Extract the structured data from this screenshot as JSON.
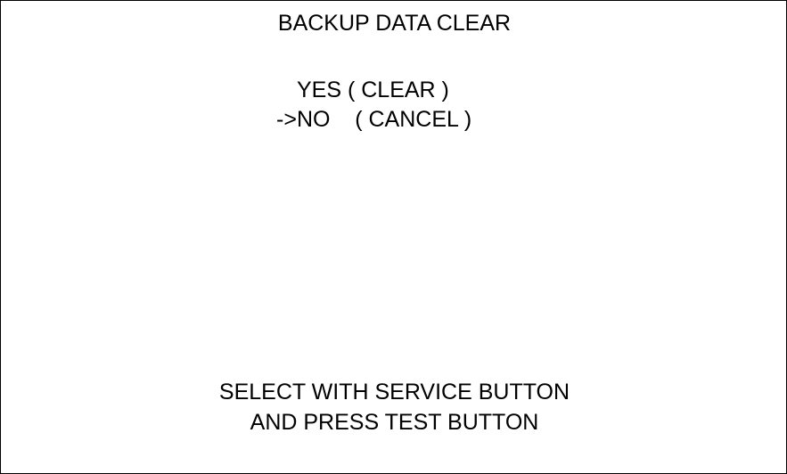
{
  "screen": {
    "title": "BACKUP DATA CLEAR",
    "options": [
      {
        "label": "YES ( CLEAR )",
        "selected": false
      },
      {
        "cursor": "->",
        "label": "NO    ( CANCEL )",
        "selected": true
      }
    ],
    "instructions": [
      "SELECT WITH SERVICE BUTTON",
      "AND PRESS TEST BUTTON"
    ]
  },
  "colors": {
    "background": "#ffffff",
    "text": "#000000",
    "border": "#000000"
  }
}
